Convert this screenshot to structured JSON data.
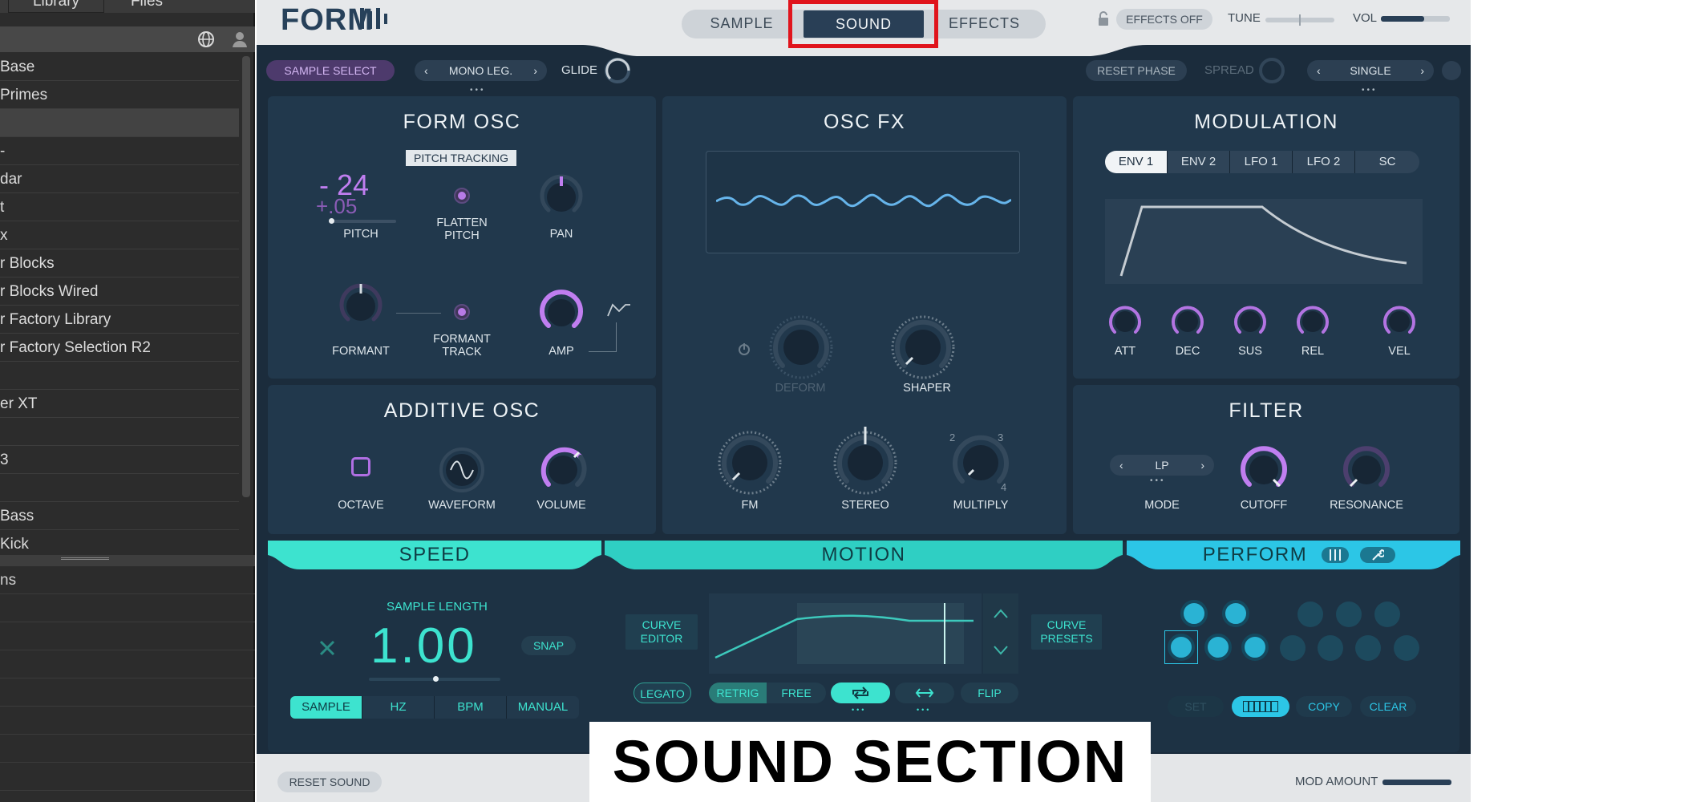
{
  "browser": {
    "tabs": [
      "Library",
      "Files"
    ],
    "items": [
      "Base",
      "Primes",
      "",
      "-",
      "dar",
      "t",
      "x",
      "r Blocks",
      "r Blocks Wired",
      "r Factory Library",
      "r Factory Selection R2",
      "",
      "er XT",
      "",
      "3",
      "",
      "Bass",
      "Kick"
    ],
    "bottom_label": "ns"
  },
  "header": {
    "logo": "FORM",
    "tabs": [
      "SAMPLE",
      "SOUND",
      "EFFECTS"
    ],
    "effects_toggle": "EFFECTS OFF",
    "tune_label": "TUNE",
    "vol_label": "VOL"
  },
  "strip": {
    "sample_select": "SAMPLE SELECT",
    "voice_mode": "MONO LEG.",
    "glide": "GLIDE",
    "reset_phase": "RESET PHASE",
    "spread": "SPREAD",
    "unison": "SINGLE"
  },
  "form_osc": {
    "title": "FORM OSC",
    "pitch_tracking": "PITCH TRACKING",
    "pitch_semi": "- 24",
    "pitch_fine": "+.05",
    "pitch": "PITCH",
    "flatten": "FLATTEN",
    "flatten2": "PITCH",
    "pan": "PAN",
    "formant": "FORMANT",
    "formant_track": "FORMANT",
    "formant_track2": "TRACK",
    "amp": "AMP"
  },
  "osc_fx": {
    "title": "OSC FX",
    "deform": "DEFORM",
    "shaper": "SHAPER",
    "fm": "FM",
    "stereo": "STEREO",
    "multiply": "MULTIPLY",
    "mult_2": "2",
    "mult_3": "3",
    "mult_4": "4"
  },
  "modulation": {
    "title": "MODULATION",
    "tabs": [
      "ENV 1",
      "ENV 2",
      "LFO 1",
      "LFO 2",
      "SC"
    ],
    "knobs": [
      "ATT",
      "DEC",
      "SUS",
      "REL",
      "VEL"
    ]
  },
  "additive_osc": {
    "title": "ADDITIVE OSC",
    "octave": "OCTAVE",
    "waveform": "WAVEFORM",
    "volume": "VOLUME"
  },
  "filter": {
    "title": "FILTER",
    "mode_value": "LP",
    "mode": "MODE",
    "cutoff": "CUTOFF",
    "resonance": "RESONANCE"
  },
  "speed": {
    "title": "SPEED",
    "sample_length": "SAMPLE LENGTH",
    "value": "1.00",
    "snap": "SNAP",
    "modes": [
      "SAMPLE",
      "HZ",
      "BPM",
      "MANUAL"
    ]
  },
  "motion": {
    "title": "MOTION",
    "curve_editor": "CURVE\nEDITOR",
    "curve_presets": "CURVE\nPRESETS",
    "legato": "LEGATO",
    "retrig": "RETRIG",
    "free": "FREE",
    "flip": "FLIP"
  },
  "perform": {
    "title": "PERFORM",
    "set": "SET",
    "copy": "COPY",
    "clear": "CLEAR"
  },
  "footer": {
    "reset_sound": "RESET SOUND",
    "mod_amount": "MOD AMOUNT"
  },
  "overlay": {
    "caption": "SOUND SECTION"
  },
  "colors": {
    "accent_purple": "#c07ef0",
    "accent_teal": "#3de3cf",
    "accent_cyan": "#2cc6e6",
    "highlight_red": "#e0141c",
    "panel": "#21384c"
  }
}
